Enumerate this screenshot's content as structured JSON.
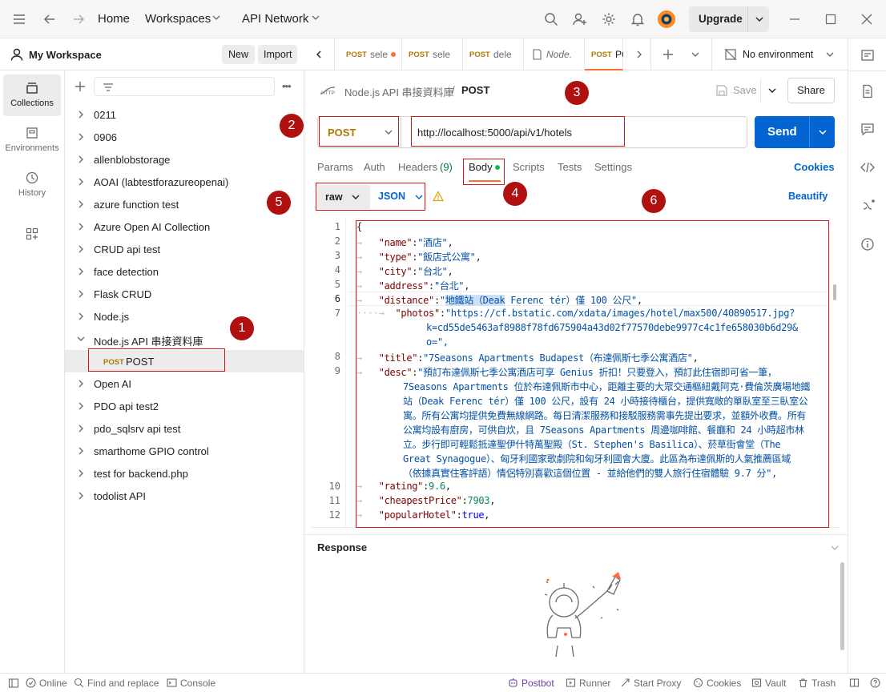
{
  "titlebar": {
    "home": "Home",
    "workspaces": "Workspaces",
    "api_network": "API Network",
    "upgrade": "Upgrade"
  },
  "workspace": {
    "name": "My Workspace",
    "new_label": "New",
    "import_label": "Import"
  },
  "rail": {
    "collections": "Collections",
    "environments": "Environments",
    "history": "History"
  },
  "collections": [
    {
      "label": "0211"
    },
    {
      "label": "0906"
    },
    {
      "label": "allenblobstorage"
    },
    {
      "label": "AOAI (labtestforazureopenai)"
    },
    {
      "label": "azure function test"
    },
    {
      "label": "Azure Open AI Collection"
    },
    {
      "label": "CRUD api test"
    },
    {
      "label": "face detection"
    },
    {
      "label": "Flask CRUD"
    },
    {
      "label": "Node.js"
    },
    {
      "label": "Node.js API 串接資料庫"
    },
    {
      "label": "Open AI"
    },
    {
      "label": "PDO api test2"
    },
    {
      "label": "pdo_sqlsrv api test"
    },
    {
      "label": "smarthome GPIO control"
    },
    {
      "label": "test for backend.php"
    },
    {
      "label": "todolist API"
    }
  ],
  "selected_request": {
    "method": "POST",
    "name": "POST"
  },
  "tabs": [
    {
      "method": "POST",
      "title": "sele",
      "dot": true
    },
    {
      "method": "POST",
      "title": "sele"
    },
    {
      "method": "POST",
      "title": "dele"
    },
    {
      "method": "",
      "title": "Node."
    },
    {
      "method": "POST",
      "title": "PO"
    }
  ],
  "environment": "No environment",
  "breadcrumb": {
    "collection": "Node.js API 串接資料庫",
    "separator": "/",
    "request": "POST"
  },
  "actions": {
    "save": "Save",
    "share": "Share"
  },
  "request": {
    "method": "POST",
    "url": "http://localhost:5000/api/v1/hotels",
    "send": "Send"
  },
  "subtabs": {
    "params": "Params",
    "auth": "Auth",
    "headers": "Headers",
    "headers_count": "(9)",
    "body": "Body",
    "scripts": "Scripts",
    "tests": "Tests",
    "settings": "Settings",
    "cookies": "Cookies"
  },
  "body_mode": {
    "raw": "raw",
    "json": "JSON",
    "beautify": "Beautify"
  },
  "badges": [
    "1",
    "2",
    "3",
    "4",
    "5",
    "6"
  ],
  "editor": {
    "line_numbers": [
      "1",
      "2",
      "3",
      "4",
      "5",
      "6",
      "7",
      "",
      "",
      "8",
      "9",
      "",
      "",
      "",
      "",
      "",
      "",
      "",
      "10",
      "11",
      "12"
    ],
    "json_lines": {
      "open": "{",
      "name_key": "\"name\"",
      "name_val": "\"酒店\"",
      "type_key": "\"type\"",
      "type_val": "\"飯店式公寓\"",
      "city_key": "\"city\"",
      "city_val": "\"台北\"",
      "address_key": "\"address\"",
      "address_val": "\"台北\"",
      "distance_key": "\"distance\"",
      "distance_val_a": "\"",
      "distance_val_hl": "地鐵站（Deak",
      "distance_val_b": " Ferenc tér）僅 100 公尺\"",
      "photos_key": "\"photos\"",
      "photos_val_1": "\"https://cf.bstatic.com/xdata/images/hotel/max500/40890517.jpg?",
      "photos_val_2": "k=cd55de5463af8988f78fd675904a43d02f77570debe9977c4c1fe658030b6d29&",
      "photos_val_3": "o=\",",
      "title_key": "\"title\"",
      "title_val": "\"7Seasons Apartments Budapest（布達佩斯七季公寓酒店\"",
      "desc_key": "\"desc\"",
      "desc_1": "\"預訂布達佩斯七季公寓酒店可享 Genius 折扣！只要登入，預訂此住宿即可省一筆，",
      "desc_2": "7Seasons Apartments 位於布達佩斯市中心，距離主要的大眾交通樞紐戴阿克·費倫茨廣場地鐵",
      "desc_3": "站（Deak Ferenc tér）僅 100 公尺，設有 24 小時接待櫃台，提供寬敞的單臥室至三臥室公",
      "desc_4": "寓。所有公寓均提供免費無線網路。每日清潔服務和接駁服務需事先提出要求，並額外收費。所有",
      "desc_5": "公寓均設有廚房，可供自炊，且 7Seasons Apartments 周邊咖啡館、餐廳和 24 小時超市林",
      "desc_6": "立。步行即可輕鬆抵達聖伊什特萬聖殿（St. Stephen's Basilica）、菸草街會堂（The",
      "desc_7": "Great Synagogue）、匈牙利國家歌劇院和匈牙利國會大廈。此區為布達佩斯的人氣推薦區域",
      "desc_8": "（依據真實住客評語）情侶特別喜歡這個位置 - 並給他們的雙人旅行住宿體驗 9.7 分\",",
      "rating_key": "\"rating\"",
      "rating_val": "9.6",
      "cheapest_key": "\"cheapestPrice\"",
      "cheapest_val": "7903",
      "popular_key": "\"popularHotel\"",
      "popular_val": "true"
    }
  },
  "response": {
    "title": "Response"
  },
  "statusbar": {
    "online": "Online",
    "find_replace": "Find and replace",
    "console": "Console",
    "postbot": "Postbot",
    "runner": "Runner",
    "start_proxy": "Start Proxy",
    "cookies": "Cookies",
    "vault": "Vault",
    "trash": "Trash"
  },
  "colors": {
    "accent": "#ff6c37",
    "send_blue": "#0265d2",
    "post_method": "#ad7a03",
    "annotation_red": "#d01818"
  }
}
